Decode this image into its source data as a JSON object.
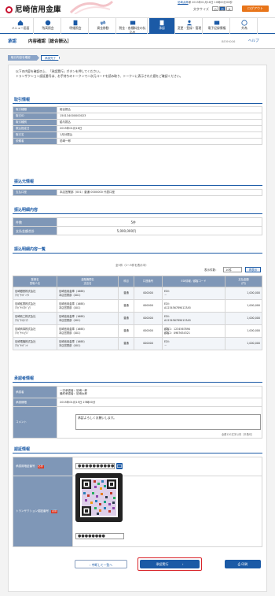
{
  "brand": {
    "name": "尼崎信用金庫",
    "accent": "#1b5aa6",
    "logo_color": "#c8102e"
  },
  "header": {
    "user_name": "尼崎太郎",
    "user_suffix": "様",
    "last_login": "2013年01月18日 10時00分00秒",
    "fontsize_label": "文字サイズ",
    "fontsize_small": "小",
    "fontsize_mid": "中",
    "fontsize_large": "大",
    "logout": "ログアウト"
  },
  "nav": [
    {
      "label": "メニュー画面",
      "icon": "home-icon"
    },
    {
      "label": "残高照会",
      "icon": "yen-icon"
    },
    {
      "label": "明細照会",
      "icon": "document-icon"
    },
    {
      "label": "資金移動",
      "icon": "transfer-icon"
    },
    {
      "label": "税金・各種料金の払込み",
      "icon": "tax-icon"
    },
    {
      "label": "承認",
      "icon": "approve-icon"
    },
    {
      "label": "変更・登録・管理",
      "icon": "user-icon"
    },
    {
      "label": "電子記録債権",
      "icon": "ebond-icon"
    },
    {
      "label": "外為",
      "icon": "globe-icon"
    }
  ],
  "title": {
    "menu": "承認",
    "page": "内容確認［総合振込］",
    "screen_id": "BSYH006",
    "help": "ヘルプ"
  },
  "steps": [
    "取引内容を確認",
    "承認完了"
  ],
  "intro": [
    "以下の内容を確認の上、「承認実行」ボタンを押してください。",
    "トランザクション認証番号は、お手持ちのトークンで二次元コードを読み取り、トークンに表示された値をご確認ください。"
  ],
  "transaction": {
    "heading": "取引情報",
    "rows": [
      {
        "k": "取引種類",
        "v": "総合振込"
      },
      {
        "k": "取引ID",
        "v": "150134000000023"
      },
      {
        "k": "取引種別",
        "v": "給与振込"
      },
      {
        "k": "振込指定日",
        "v": "2015年01月16日"
      },
      {
        "k": "取引名",
        "v": "1月分振込"
      },
      {
        "k": "依頼者",
        "v": "尼崎一郎"
      }
    ]
  },
  "source": {
    "heading": "振込元情報",
    "rows": [
      {
        "k": "支払口座",
        "v": "本店営業部（001）普通 0000000 代表口座"
      }
    ]
  },
  "summary": {
    "heading": "振込明細内容",
    "rows": [
      {
        "k": "件数",
        "v": "5件"
      },
      {
        "k": "支払金額合計",
        "v": "5,000,000円"
      }
    ]
  },
  "list": {
    "heading": "振込明細内容一覧",
    "paging": "全5件（1～5件を表示中）",
    "perpage_label": "表示件数：",
    "perpage": "10件",
    "resort": "再表示",
    "columns": [
      "登録名\n受取人名",
      "金融機関名\n支店名",
      "科目",
      "口座番号",
      "EDI情報／顧客コード",
      "支払金額\n(円)"
    ],
    "rows": [
      {
        "name": "尼崎銀鉄株式会社\nｱﾏｶﾞｻｷｷﾞﾝﾃﾂ",
        "bank": "尼崎信用金庫（1688）\n本店営業部（001）",
        "type": "普通",
        "acct": "000000",
        "edi": "EDI：\n－",
        "amt": "1,000,000"
      },
      {
        "name": "尼崎鉱業株式会社\nｱﾏｶﾞｻｷｺｳｷﾞｮｳ",
        "bank": "尼崎信用金庫（1688）\n本店営業部（001）",
        "type": "普通",
        "acct": "000000",
        "edi": "EDI：\nA1234567890123A5",
        "amt": "1,000,000"
      },
      {
        "name": "尼崎精工株式会社\nｱﾏｶﾞｻｷｾｲｺｳ",
        "bank": "尼崎信用金庫（1688）\n本店営業部（001）",
        "type": "普通",
        "acct": "000000",
        "edi": "EDI：\nA1234567890123A5",
        "amt": "1,000,000"
      },
      {
        "name": "尼崎商事株式会社\nｱﾏｶﾞｻｷｼｮｳｼﾞ",
        "bank": "尼崎信用金庫（1688）\n本店営業部（001）",
        "type": "普通",
        "acct": "000000",
        "edi": "顧客1：1234567890\n顧客2：0987654321",
        "amt": "1,000,000"
      },
      {
        "name": "尼崎電機株式会社\nｱﾏｶﾞｻｷﾃﾞﾝｷ",
        "bank": "尼崎信用金庫（1688）\n本店営業部（001）",
        "type": "普通",
        "acct": "000000",
        "edi": "EDI：\n－",
        "amt": "1,000,000"
      }
    ]
  },
  "approver": {
    "heading": "承認者情報",
    "rows": [
      {
        "k": "承認者",
        "v": "一次承認者：尼崎一郎\n最終承認者：尼崎太郎"
      },
      {
        "k": "承認期限",
        "v": "2015年01月15日 23時00分"
      }
    ],
    "comment_label": "コメント",
    "comment": "承認よろしくお願いします。",
    "comment_note": "全角120文字以内［半角可］"
  },
  "auth": {
    "heading": "認証情報",
    "pw_label": "承認用暗証番号",
    "pw_value": "●●●●●●●●●●",
    "required": "必須",
    "tx_label": "トランザクション認証番号",
    "tx_value": "●●●●●●●●"
  },
  "buttons": {
    "back": "中断して一覧へ",
    "execute": "承認実行",
    "print": "印刷"
  }
}
